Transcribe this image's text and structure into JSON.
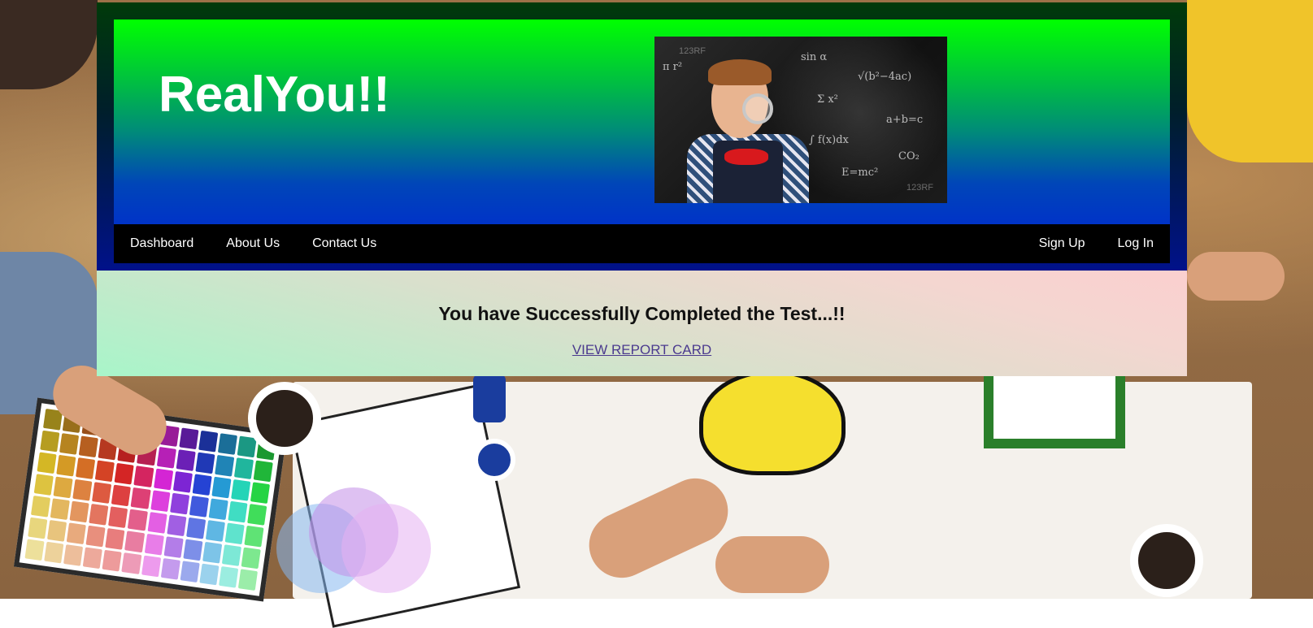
{
  "brand": {
    "title": "RealYou!!"
  },
  "hero_image": {
    "alt": "Boy with magnifying glass in front of chalkboard",
    "watermark": "123RF",
    "chalk_text": [
      "sin α",
      "√(b²−4ac)",
      "Σ x²",
      "a+b=c",
      "∫ f(x)dx",
      "CO₂",
      "E=mc²",
      "π r²"
    ]
  },
  "nav": {
    "left": [
      {
        "label": "Dashboard"
      },
      {
        "label": "About Us"
      },
      {
        "label": "Contact Us"
      }
    ],
    "right": [
      {
        "label": "Sign Up"
      },
      {
        "label": "Log In"
      }
    ]
  },
  "message": {
    "heading": "You have Successfully Completed the Test...!!",
    "link_label": "VIEW REPORT CARD"
  },
  "colors": {
    "hero_top": "#00ff00",
    "hero_bottom": "#0033c8",
    "nav_bg": "#000000",
    "link": "#4b3a8e"
  }
}
